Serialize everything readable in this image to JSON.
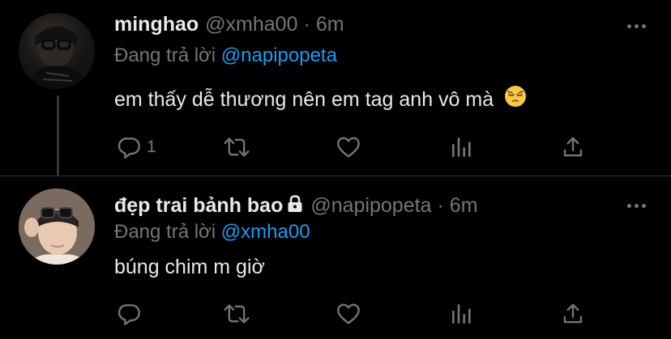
{
  "tweets": [
    {
      "name": "minghao",
      "handle": "@xmha00",
      "separator": "·",
      "time": "6m",
      "reply_prefix": "Đang trả lời",
      "reply_to": "@napipopeta",
      "text": "em thấy dễ thương nên em tag anh vô mà",
      "emoji": "pensive-face",
      "reply_count": "1",
      "locked": false
    },
    {
      "name": "đẹp trai bảnh bao",
      "handle": "@napipopeta",
      "separator": "·",
      "time": "6m",
      "reply_prefix": "Đang trả lời",
      "reply_to": "@xmha00",
      "text": "búng chim m giờ",
      "reply_count": "",
      "locked": true
    }
  ],
  "colors": {
    "background": "#000000",
    "text": "#e7e9ea",
    "muted": "#71767b",
    "link": "#1d9bf0",
    "divider": "#2f3336"
  },
  "icons": [
    "reply-icon",
    "retweet-icon",
    "like-icon",
    "analytics-icon",
    "share-icon",
    "more-icon",
    "lock-icon"
  ]
}
